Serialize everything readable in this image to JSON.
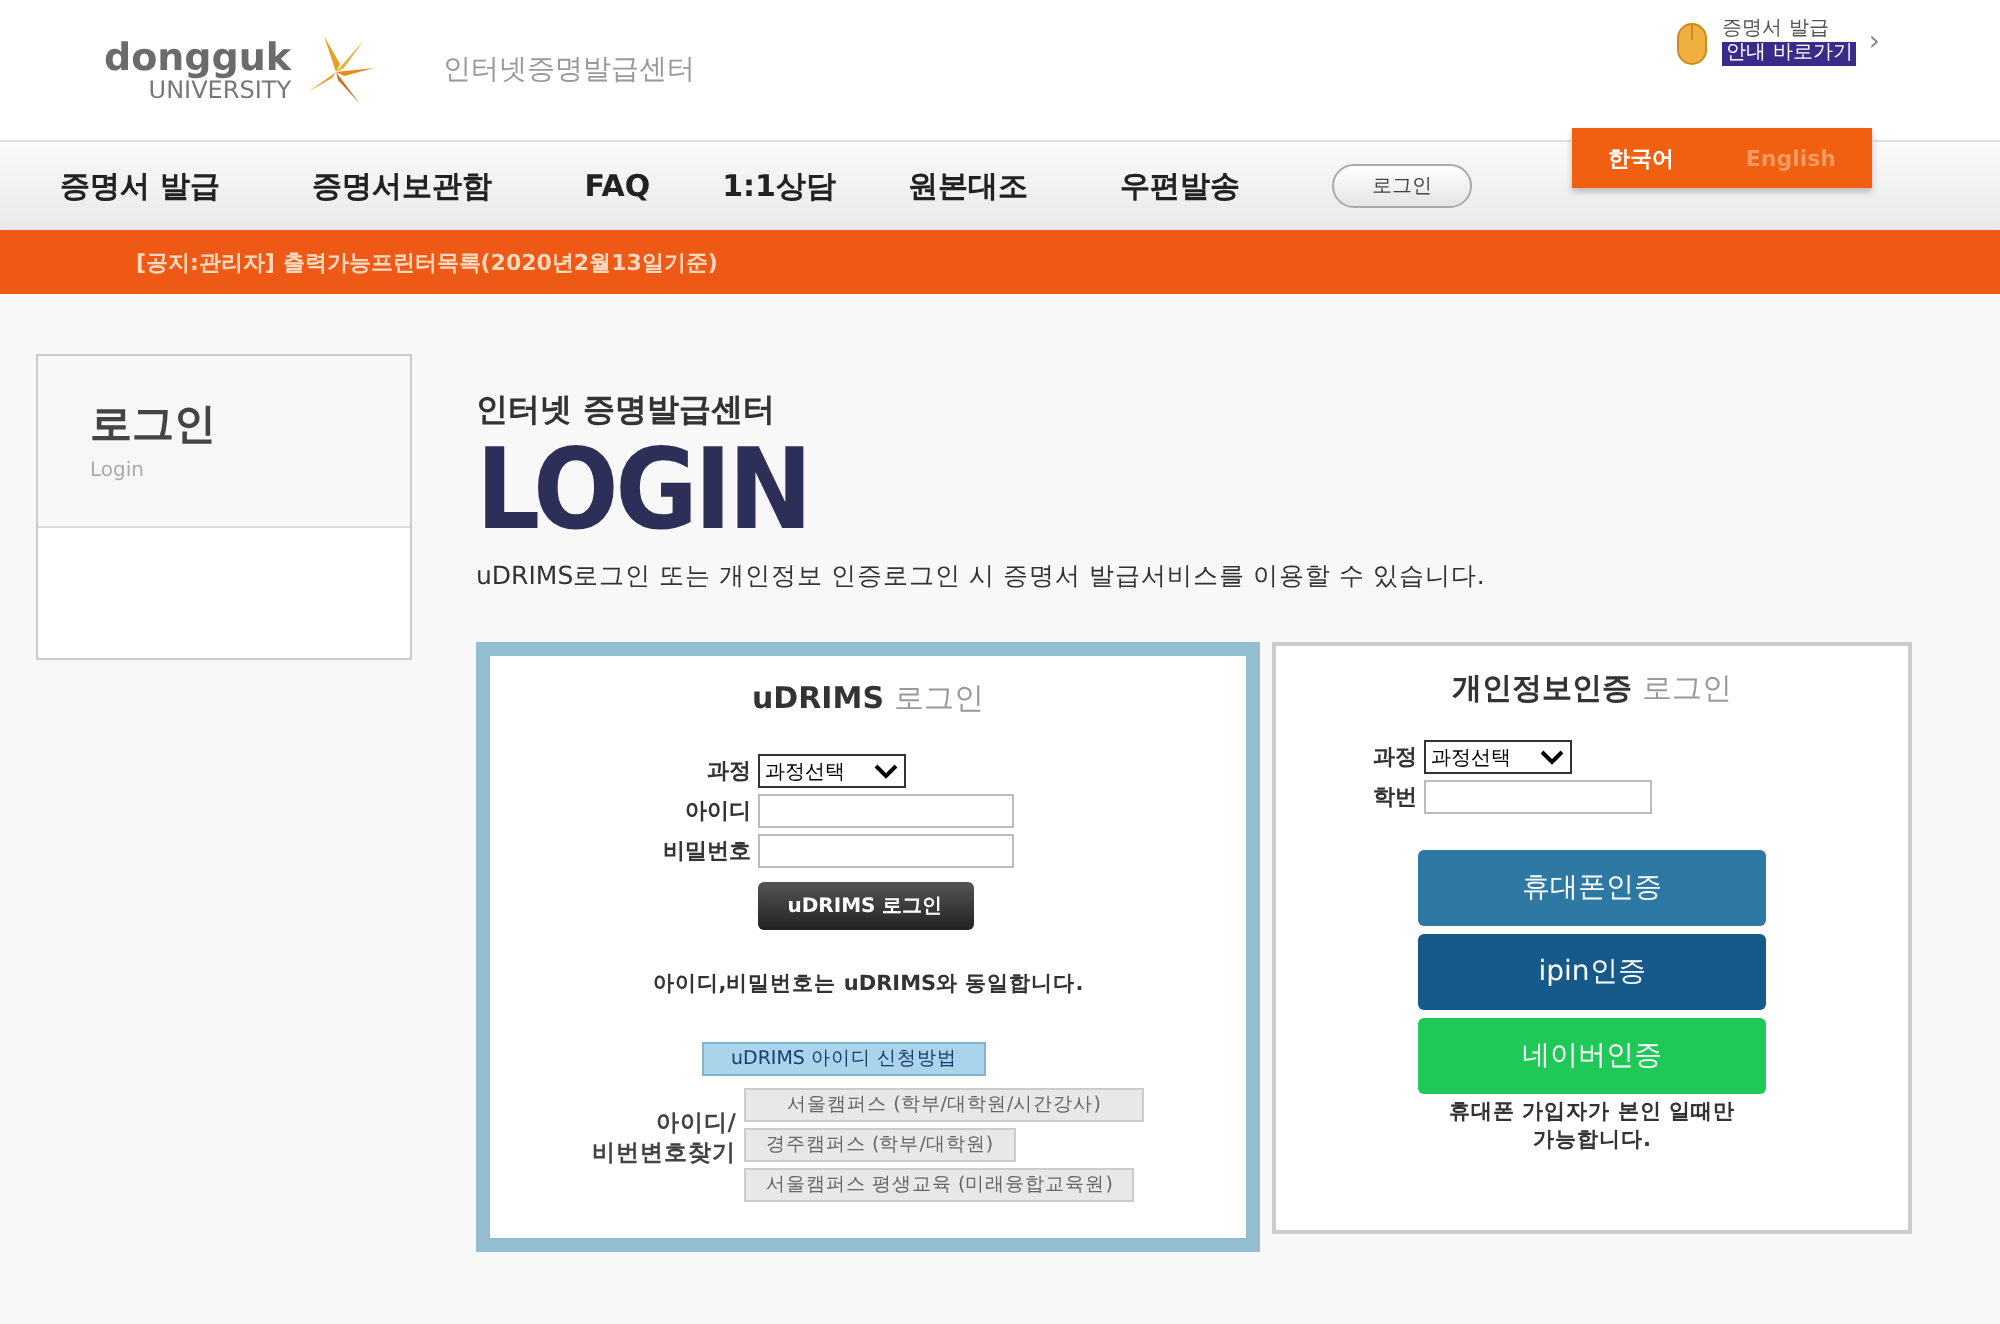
{
  "header": {
    "logo_top": "dongguk",
    "logo_bottom": "UNIVERSITY",
    "site_title": "인터넷증명발급센터",
    "guide_top": "증명서 발급",
    "guide_bottom": "안내 바로가기",
    "guide_arrow": "›"
  },
  "languages": [
    {
      "label": "한국어",
      "selected": true
    },
    {
      "label": "English",
      "selected": false
    }
  ],
  "nav": {
    "items": [
      "증명서 발급",
      "증명서보관함",
      "FAQ",
      "1:1상담",
      "원본대조",
      "우편발송"
    ],
    "login_button": "로그인"
  },
  "notice": "[공지:관리자] 출력가능프린터목록(2020년2월13일기준)",
  "sidebar": {
    "title": "로그인",
    "subtitle": "Login"
  },
  "main": {
    "kicker": "인터넷 증명발급센터",
    "title": "LOGIN",
    "description": "uDRIMS로그인 또는 개인정보 인증로그인 시 증명서 발급서비스를 이용할 수 있습니다."
  },
  "udrims": {
    "title_main": "uDRIMS",
    "title_sub": "로그인",
    "course_label": "과정",
    "course_select": "과정선택",
    "id_label": "아이디",
    "password_label": "비밀번호",
    "login_button": "uDRIMS 로그인",
    "note": "아이디,비밀번호는 uDRIMS와 동일합니다.",
    "apply_button": "uDRIMS 아이디 신청방법",
    "find_label_1": "아이디/",
    "find_label_2": "비번변호찾기",
    "find_buttons": [
      "서울캠퍼스 (학부/대학원/시간강사)",
      "경주캠퍼스 (학부/대학원)",
      "서울캠퍼스 평생교육 (미래융합교육원)"
    ]
  },
  "personal": {
    "title_main": "개인정보인증",
    "title_sub": "로그인",
    "course_label": "과정",
    "course_select": "과정선택",
    "student_id_label": "학번",
    "auth_buttons": [
      {
        "label": "휴대폰인증",
        "kind": "phone"
      },
      {
        "label": "ipin인증",
        "kind": "ipin"
      },
      {
        "label": "네이버인증",
        "kind": "naver"
      }
    ],
    "note": "휴대폰 가입자가 본인 일때만 가능합니다."
  }
}
